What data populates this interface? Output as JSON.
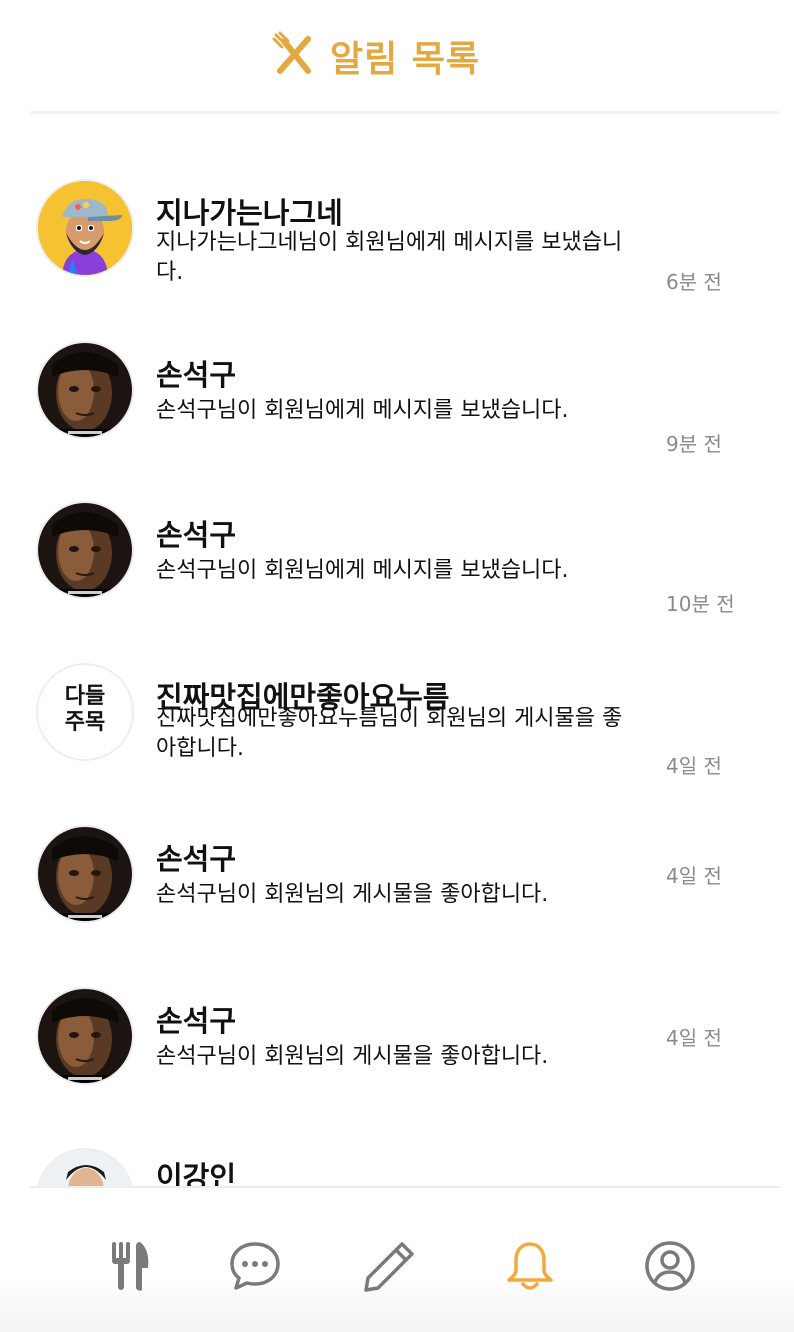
{
  "header": {
    "title": "알림 목록",
    "icon": "utensils-crossed-icon",
    "color": "#e5a840"
  },
  "notifications": [
    {
      "name": "지나가는나그네",
      "message": "지나가는나그네님이 회원님에게 메시지를 보냈습니다.",
      "time": "6분 전",
      "avatar": "cartoon-bearded-man-avatar"
    },
    {
      "name": "손석구",
      "message": "손석구님이 회원님에게 메시지를 보냈습니다.",
      "time": "9분 전",
      "avatar": "actor-photo-avatar"
    },
    {
      "name": "손석구",
      "message": "손석구님이 회원님에게 메시지를 보냈습니다.",
      "time": "10분 전",
      "avatar": "actor-photo-avatar"
    },
    {
      "name": "진짜맛집에만좋아요누름",
      "message": "진짜맛집에만좋아요누름님이 회원님의 게시물을 좋아합니다.",
      "time": "4일 전",
      "avatar": "calligraphy-avatar",
      "avatar_text": [
        "다들",
        "주목"
      ]
    },
    {
      "name": "손석구",
      "message": "손석구님이 회원님의 게시물을 좋아합니다.",
      "time": "4일 전",
      "avatar": "actor-photo-avatar"
    },
    {
      "name": "손석구",
      "message": "손석구님이 회원님의 게시물을 좋아합니다.",
      "time": "4일 전",
      "avatar": "actor-photo-avatar"
    },
    {
      "name": "이강인",
      "message": "",
      "time": "",
      "avatar": "person-photo-avatar"
    }
  ],
  "nav": {
    "items": [
      {
        "icon": "fork-knife-icon",
        "active": false
      },
      {
        "icon": "chat-bubble-icon",
        "active": false
      },
      {
        "icon": "pencil-icon",
        "active": false
      },
      {
        "icon": "bell-icon",
        "active": true
      },
      {
        "icon": "profile-icon",
        "active": false
      }
    ],
    "active_color": "#f0a93a",
    "inactive_color": "#7a7a7a"
  }
}
